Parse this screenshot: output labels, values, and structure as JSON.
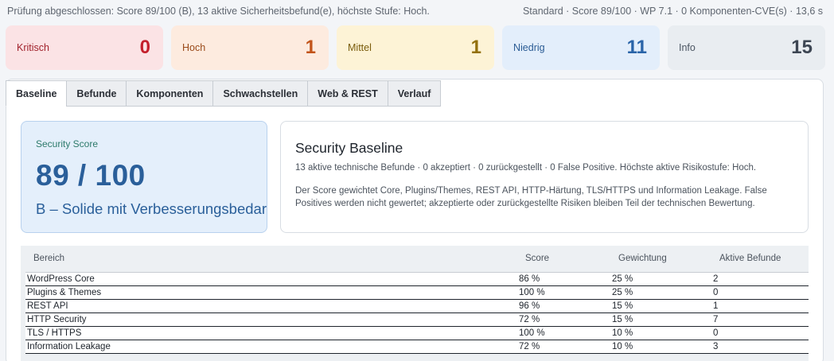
{
  "status_bar": {
    "left": "Prüfung abgeschlossen: Score 89/100 (B), 13 aktive Sicherheitsbefund(e), höchste Stufe: Hoch.",
    "right": "Standard · Score 89/100 · WP 7.1 · 0 Komponenten-CVE(s) · 13,6 s"
  },
  "severity_cards": [
    {
      "label": "Kritisch",
      "count": "0"
    },
    {
      "label": "Hoch",
      "count": "1"
    },
    {
      "label": "Mittel",
      "count": "1"
    },
    {
      "label": "Niedrig",
      "count": "11"
    },
    {
      "label": "Info",
      "count": "15"
    }
  ],
  "tabs": [
    {
      "label": "Baseline",
      "active": true
    },
    {
      "label": "Befunde",
      "active": false
    },
    {
      "label": "Komponenten",
      "active": false
    },
    {
      "label": "Schwachstellen",
      "active": false
    },
    {
      "label": "Web & REST",
      "active": false
    },
    {
      "label": "Verlauf",
      "active": false
    }
  ],
  "score_card": {
    "label": "Security Score",
    "value": "89 / 100",
    "grade": "B – Solide mit Verbesserungsbedarf"
  },
  "baseline": {
    "title": "Security Baseline",
    "summary": "13 aktive technische Befunde · 0 akzeptiert · 0 zurückgestellt · 0 False Positive. Höchste aktive Risikostufe: Hoch.",
    "description": "Der Score gewichtet Core, Plugins/Themes, REST API, HTTP-Härtung, TLS/HTTPS und Information Leakage. False Positives werden nicht gewertet; akzeptierte oder zurückgestellte Risiken bleiben Teil der technischen Bewertung."
  },
  "table": {
    "headers": [
      "Bereich",
      "Score",
      "Gewichtung",
      "Aktive Befunde"
    ],
    "rows": [
      [
        "WordPress Core",
        "86 %",
        "25 %",
        "2"
      ],
      [
        "Plugins & Themes",
        "100 %",
        "25 %",
        "0"
      ],
      [
        "REST API",
        "96 %",
        "15 %",
        "1"
      ],
      [
        "HTTP Security",
        "72 %",
        "15 %",
        "7"
      ],
      [
        "TLS / HTTPS",
        "100 %",
        "10 %",
        "0"
      ],
      [
        "Information Leakage",
        "72 %",
        "10 %",
        "3"
      ]
    ]
  }
}
